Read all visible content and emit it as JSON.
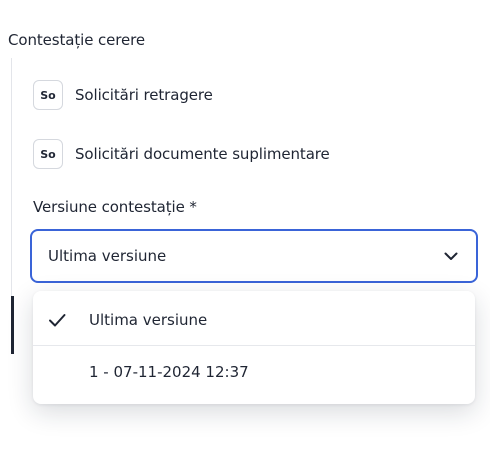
{
  "section": {
    "title": "Contestație cerere"
  },
  "links": [
    {
      "avatar": "So",
      "label": "Solicitări retragere"
    },
    {
      "avatar": "So",
      "label": "Solicitări documente suplimentare"
    }
  ],
  "field": {
    "label": "Versiune contestație *",
    "selected": "Ultima versiune",
    "options": [
      {
        "label": "Ultima versiune",
        "selected": true
      },
      {
        "label": "1 - 07-11-2024 12:37",
        "selected": false
      }
    ]
  },
  "colors": {
    "accent": "#3a64d8",
    "text": "#1f2533",
    "border": "#d5d8de"
  },
  "icons": {
    "check": "check-icon",
    "chevron": "chevron-down-icon"
  }
}
